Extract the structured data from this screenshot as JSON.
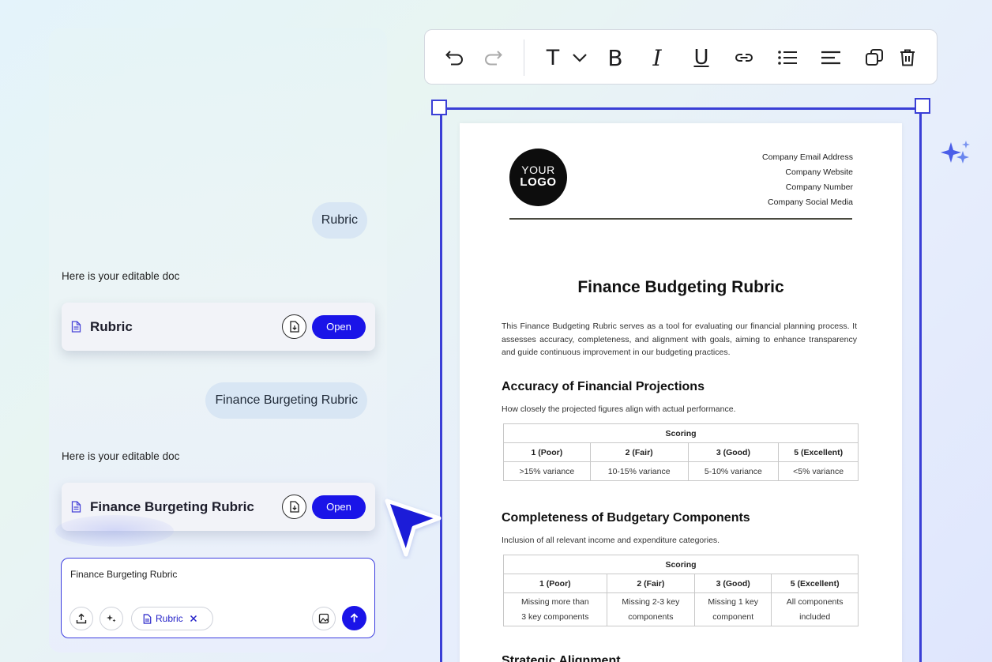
{
  "chat": {
    "messages": [
      {
        "role": "user",
        "text": "Rubric"
      },
      {
        "role": "assistant",
        "text": "Here is your editable doc",
        "doc_title": "Rubric",
        "open_label": "Open"
      },
      {
        "role": "user",
        "text": "Finance Burgeting Rubric"
      },
      {
        "role": "assistant",
        "text": "Here is your editable doc",
        "doc_title": "Finance Burgeting Rubric",
        "open_label": "Open"
      }
    ],
    "composer": {
      "value": "Finance Burgeting Rubric",
      "attachment_chip": "Rubric"
    }
  },
  "toolbar": {
    "icons": [
      "undo-icon",
      "redo-icon",
      "text-style-icon",
      "chevron-down-icon",
      "bold-icon",
      "italic-icon",
      "underline-icon",
      "link-icon",
      "bullet-list-icon",
      "align-left-icon",
      "duplicate-icon",
      "delete-icon"
    ],
    "text_glyph": "T",
    "bold_glyph": "B",
    "italic_glyph": "I",
    "underline_glyph": "U"
  },
  "document": {
    "logo_line1": "YOUR",
    "logo_line2": "LOGO",
    "contact": [
      "Company Email Address",
      "Company Website",
      "Company Number",
      "Company Social Media"
    ],
    "title": "Finance Budgeting Rubric",
    "intro": "This Finance Budgeting Rubric serves as a tool for evaluating our financial planning process. It assesses accuracy, completeness, and alignment with goals, aiming to enhance transparency and guide continuous improvement in our budgeting practices.",
    "sections": [
      {
        "heading": "Accuracy of Financial Projections",
        "description": "How closely the projected figures align with actual performance.",
        "scoring_label": "Scoring",
        "levels": [
          "1 (Poor)",
          "2 (Fair)",
          "3 (Good)",
          "5 (Excellent)"
        ],
        "criteria": [
          ">15% variance",
          "10-15% variance",
          "5-10% variance",
          "<5% variance"
        ]
      },
      {
        "heading": "Completeness of Budgetary Components",
        "description": "Inclusion of all relevant income and expenditure categories.",
        "scoring_label": "Scoring",
        "levels": [
          "1 (Poor)",
          "2 (Fair)",
          "3 (Good)",
          "5 (Excellent)"
        ],
        "criteria": [
          [
            "Missing more than",
            "3 key components"
          ],
          [
            "Missing 2-3 key",
            "components"
          ],
          [
            "Missing 1 key",
            "component"
          ],
          [
            "All components",
            "included"
          ]
        ]
      },
      {
        "heading": "Strategic Alignment"
      }
    ]
  },
  "colors": {
    "accent": "#1a14e8",
    "selection": "#3a3fd6",
    "bubble": "#d8e6f4"
  }
}
